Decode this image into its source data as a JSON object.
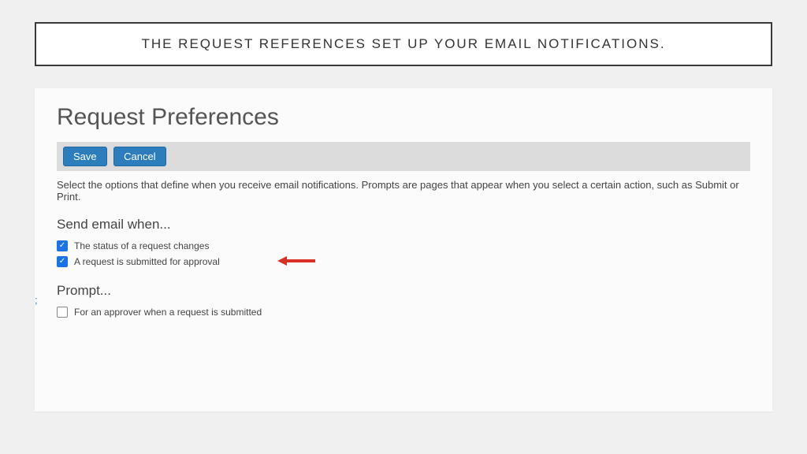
{
  "banner": {
    "text": "THE REQUEST REFERENCES SET UP YOUR EMAIL NOTIFICATIONS."
  },
  "page": {
    "title": "Request Preferences"
  },
  "actions": {
    "save": "Save",
    "cancel": "Cancel"
  },
  "description": "Select the options that define when you receive email notifications. Prompts are pages that appear when you select a certain action, such as Submit or Print.",
  "sections": {
    "email": {
      "heading": "Send email when...",
      "options": [
        {
          "label": "The status of a request changes",
          "checked": true
        },
        {
          "label": "A request is submitted for approval",
          "checked": true
        }
      ]
    },
    "prompt": {
      "heading": "Prompt...",
      "options": [
        {
          "label": "For an approver when a request is submitted",
          "checked": false
        }
      ]
    }
  },
  "colors": {
    "primary_button": "#2b7dbc",
    "checkbox_checked": "#1a73e8",
    "callout_arrow": "#d93025"
  },
  "edge_marker": ";"
}
